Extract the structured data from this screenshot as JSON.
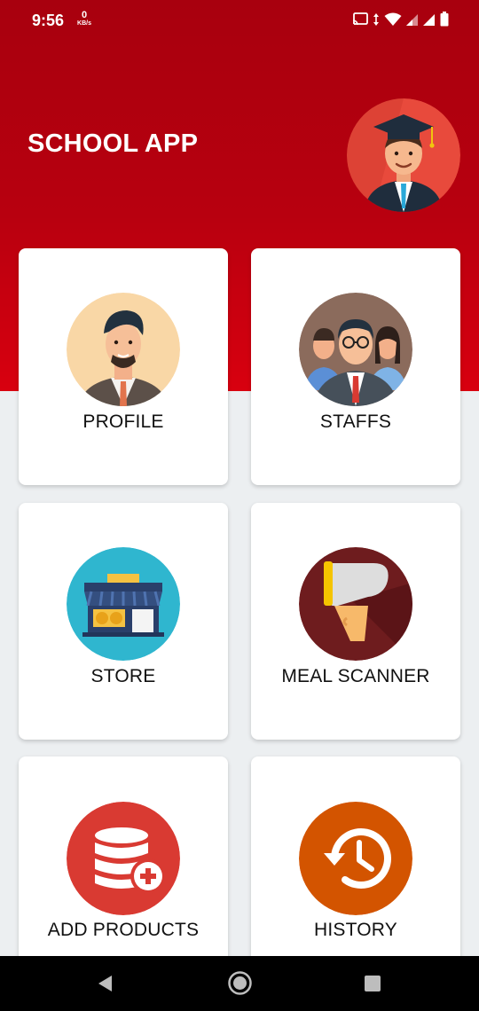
{
  "status_bar": {
    "time": "9:56",
    "net_speed": "0",
    "net_unit": "KB/s",
    "icons": [
      "cast-icon",
      "data-arrows-icon",
      "wifi-icon",
      "signal-icon",
      "signal-icon",
      "battery-icon"
    ]
  },
  "header": {
    "title": "SCHOOL APP",
    "avatar_icon": "graduate-avatar-icon"
  },
  "menu": [
    {
      "label": "PROFILE",
      "icon": "profile-person-icon",
      "color": "#f9d7a6"
    },
    {
      "label": "STAFFS",
      "icon": "staff-group-icon",
      "color": "#8b6b5c"
    },
    {
      "label": "STORE",
      "icon": "store-front-icon",
      "color": "#2fb6cf"
    },
    {
      "label": "MEAL SCANNER",
      "icon": "barcode-scanner-icon",
      "color": "#6e1c1e"
    },
    {
      "label": "ADD PRODUCTS",
      "icon": "database-add-icon",
      "color": "#d93a32"
    },
    {
      "label": "HISTORY",
      "icon": "history-clock-icon",
      "color": "#d35400"
    }
  ],
  "nav_bar": {
    "buttons": [
      "back-icon",
      "home-icon",
      "recents-icon"
    ]
  },
  "colors": {
    "header_top": "#a8000e",
    "header_bottom": "#d8000f",
    "background": "#eceff1",
    "card": "#ffffff"
  }
}
